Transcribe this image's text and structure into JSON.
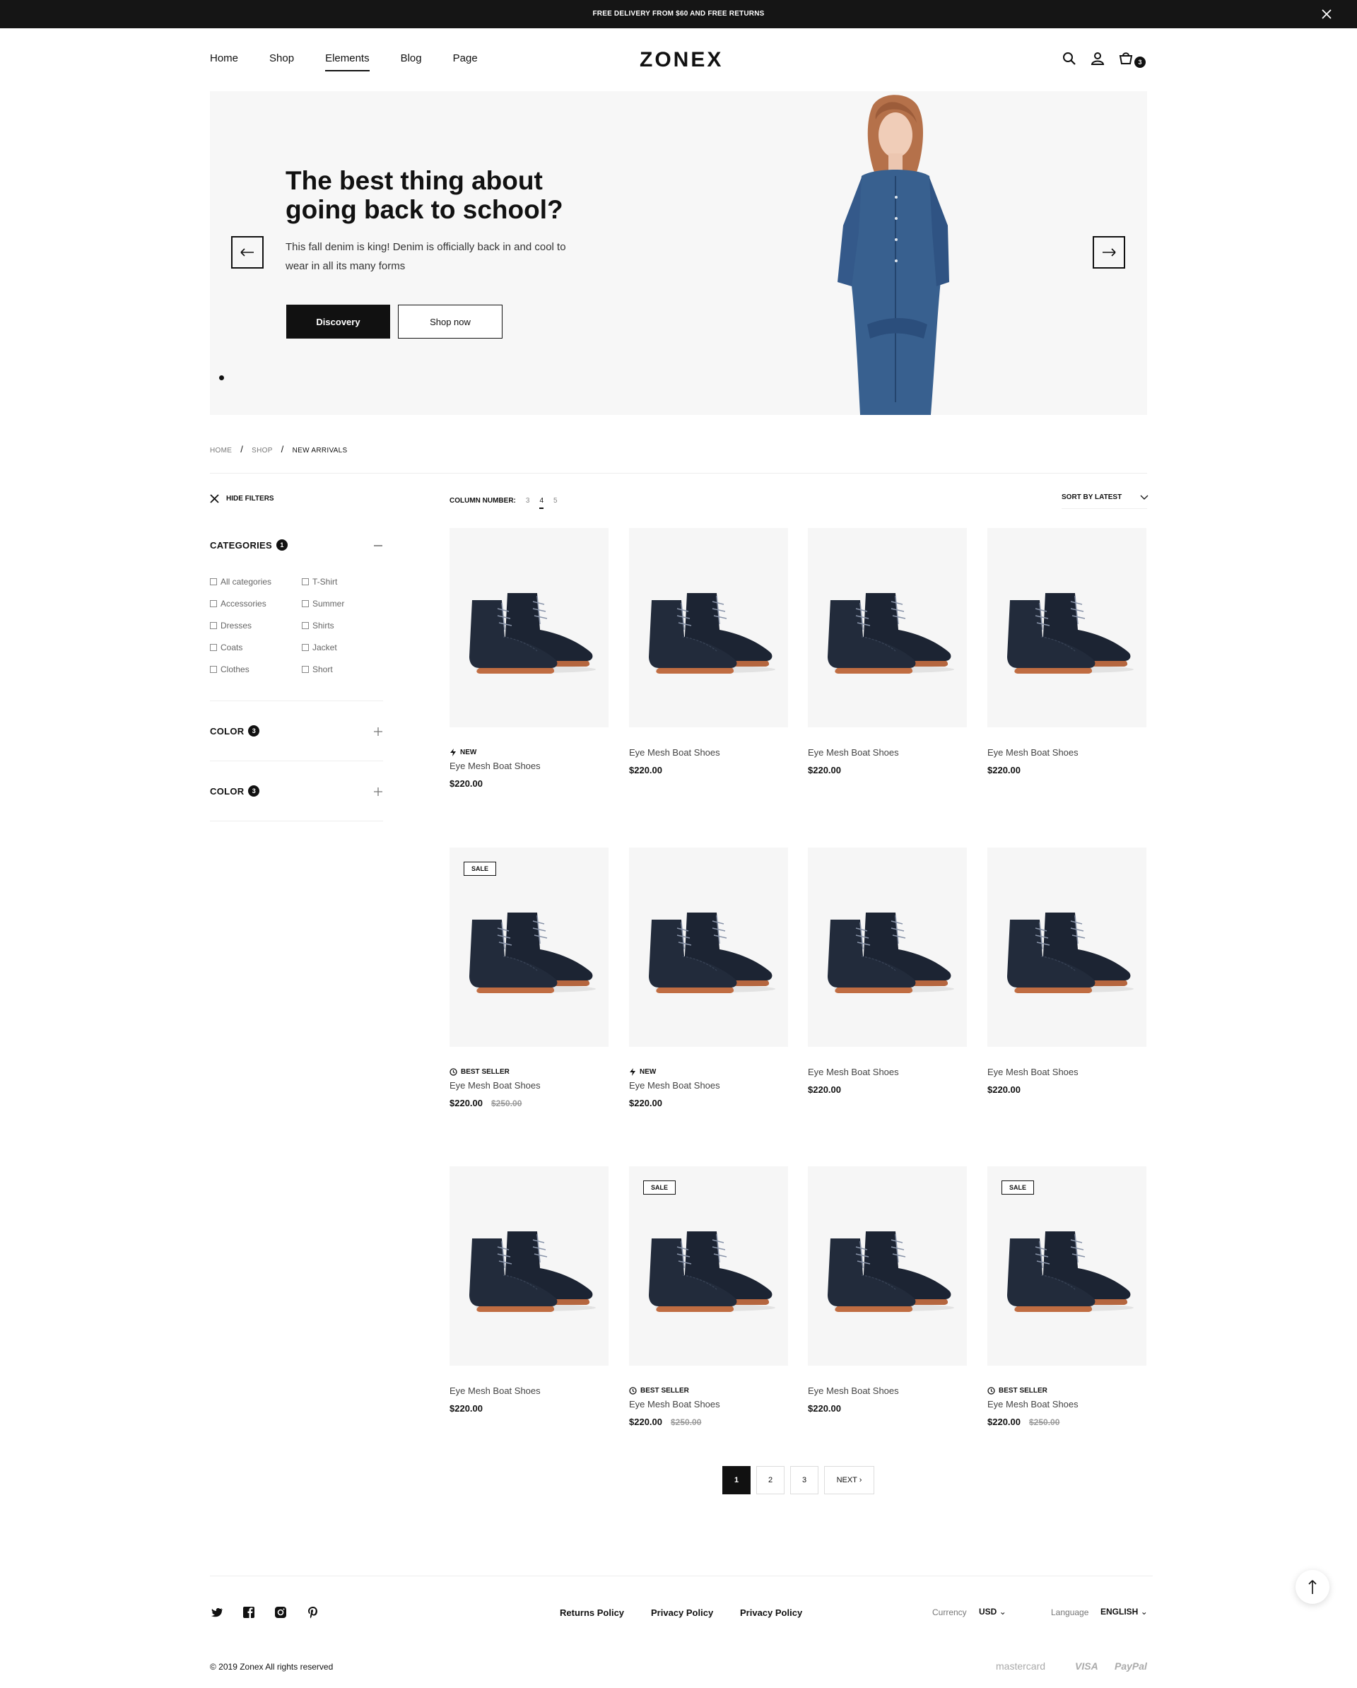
{
  "topbar": {
    "text": "FREE DELIVERY FROM $60 AND FREE RETURNS"
  },
  "header": {
    "nav": [
      "Home",
      "Shop",
      "Elements",
      "Blog",
      "Page"
    ],
    "logo": "ZONEX",
    "cart_count": "3"
  },
  "hero": {
    "title": "The best thing about going back to school?",
    "text": "This fall denim is king! Denim is officially back in and cool to wear in all its many forms",
    "primary_button": "Discovery",
    "secondary_button": "Shop now"
  },
  "breadcrumb": [
    "HOME",
    "SHOP",
    "NEW ARRIVALS"
  ],
  "sidebar": {
    "hide_filters": "HIDE FILTERS",
    "categories_title": "CATEGORIES",
    "categories_count": "1",
    "categories_col1": [
      "All categories",
      "Accessories",
      "Dresses",
      "Coats",
      "Clothes"
    ],
    "categories_col2": [
      "T-Shirt",
      "Summer",
      "Shirts",
      "Jacket",
      "Short"
    ],
    "color1_title": "COLOR",
    "color1_count": "3",
    "color2_title": "COLOR",
    "color2_count": "3"
  },
  "toolbar": {
    "column_label": "COLUMN NUMBER:",
    "column_options": [
      "3",
      "4",
      "5"
    ],
    "column_selected": "4",
    "sort_label": "SORT BY LATEST"
  },
  "products": [
    {
      "name": "Eye Mesh Boat Shoes",
      "price": "$220.00",
      "old_price": "",
      "tag": "NEW",
      "sale": ""
    },
    {
      "name": "Eye Mesh Boat Shoes",
      "price": "$220.00",
      "old_price": "",
      "tag": "",
      "sale": ""
    },
    {
      "name": "Eye Mesh Boat Shoes",
      "price": "$220.00",
      "old_price": "",
      "tag": "",
      "sale": ""
    },
    {
      "name": "Eye Mesh Boat Shoes",
      "price": "$220.00",
      "old_price": "",
      "tag": "",
      "sale": ""
    },
    {
      "name": "Eye Mesh Boat Shoes",
      "price": "$220.00",
      "old_price": "$250.00",
      "tag": "BEST SELLER",
      "sale": "SALE"
    },
    {
      "name": "Eye Mesh Boat Shoes",
      "price": "$220.00",
      "old_price": "",
      "tag": "NEW",
      "sale": ""
    },
    {
      "name": "Eye Mesh Boat Shoes",
      "price": "$220.00",
      "old_price": "",
      "tag": "",
      "sale": ""
    },
    {
      "name": "Eye Mesh Boat Shoes",
      "price": "$220.00",
      "old_price": "",
      "tag": "",
      "sale": ""
    },
    {
      "name": "Eye Mesh Boat Shoes",
      "price": "$220.00",
      "old_price": "",
      "tag": "",
      "sale": ""
    },
    {
      "name": "Eye Mesh Boat Shoes",
      "price": "$220.00",
      "old_price": "$250.00",
      "tag": "BEST SELLER",
      "sale": "SALE"
    },
    {
      "name": "Eye Mesh Boat Shoes",
      "price": "$220.00",
      "old_price": "",
      "tag": "",
      "sale": ""
    },
    {
      "name": "Eye Mesh Boat Shoes",
      "price": "$220.00",
      "old_price": "$250.00",
      "tag": "BEST SELLER",
      "sale": "SALE"
    }
  ],
  "pagination": {
    "pages": [
      "1",
      "2",
      "3"
    ],
    "current": "1",
    "next": "NEXT"
  },
  "footer": {
    "social_icons": [
      "twitter-icon",
      "facebook-icon",
      "instagram-icon",
      "pinterest-icon"
    ],
    "links": [
      "Returns Policy",
      "Privacy Policy",
      "Privacy Policy"
    ],
    "currency_label": "Currency",
    "currency_value": "USD",
    "language_label": "Language",
    "language_value": "ENGLISH",
    "copyright": "© 2019 Zonex All rights reserved",
    "payments": [
      "mastercard",
      "VISA",
      "PayPal"
    ]
  },
  "colors": {
    "dark": "#111111",
    "topbar": "#151515",
    "hero_bg": "#f7f7f7",
    "card_bg": "#f6f6f6"
  }
}
